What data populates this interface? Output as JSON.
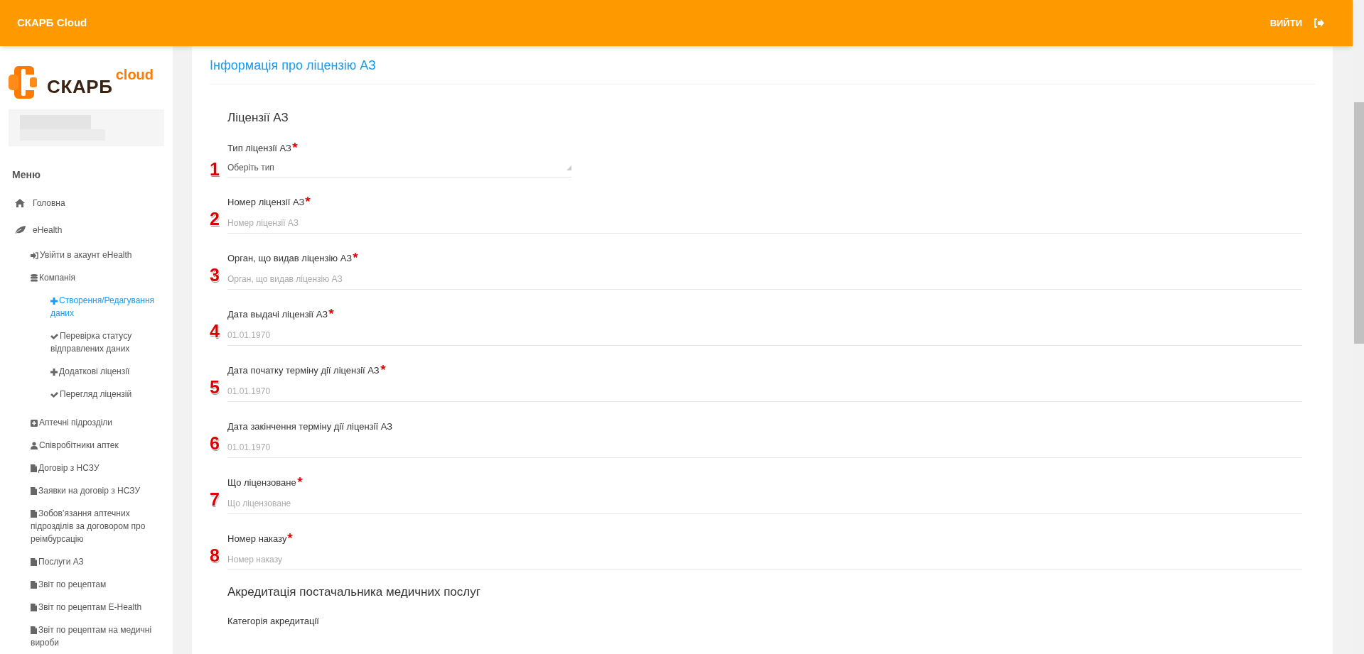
{
  "header": {
    "brand": "СКАРБ Cloud",
    "logout": "ВИЙТИ"
  },
  "sidebar": {
    "logo": {
      "word": "СКАРБ",
      "suffix": "cloud"
    },
    "menu_title": "Меню",
    "items": [
      {
        "label": "Головна",
        "selected": false
      },
      {
        "label": "eHealth",
        "selected": false,
        "children": [
          {
            "label": "Увійти в акаунт eHealth",
            "selected": false
          },
          {
            "label": "Компанія",
            "selected": false,
            "children": [
              {
                "label": "Створення/Редагування даних",
                "selected": true
              },
              {
                "label": "Перевірка статусу відправлених даних",
                "selected": false
              },
              {
                "label": "Додаткові ліцензії",
                "selected": false
              },
              {
                "label": "Перегляд ліцензій",
                "selected": false
              }
            ]
          },
          {
            "label": "Аптечні підрозділи",
            "selected": false
          },
          {
            "label": "Співробітники аптек",
            "selected": false
          },
          {
            "label": "Договір з НСЗУ",
            "selected": false
          },
          {
            "label": "Заявки на договір з НСЗУ",
            "selected": false
          },
          {
            "label": "Зобов’язання аптечних підрозділів за договором про реімбурсацію",
            "selected": false
          },
          {
            "label": "Послуги АЗ",
            "selected": false
          },
          {
            "label": "Звіт по рецептам",
            "selected": false
          },
          {
            "label": "Звіт по рецептам E-Health",
            "selected": false
          },
          {
            "label": "Звіт по рецептам на медичні вироби",
            "selected": false
          }
        ]
      }
    ]
  },
  "page": {
    "title": "Інформація про ліцензію АЗ",
    "sections": [
      {
        "title": "Ліцензії АЗ",
        "fields": [
          {
            "kind": "select",
            "label": "Тип ліцензії АЗ",
            "required": true,
            "placeholder": "Оберіть тип",
            "marker": "1"
          },
          {
            "kind": "input",
            "label": "Номер ліцензії АЗ",
            "required": true,
            "placeholder": "Номер ліцензії АЗ",
            "marker": "2"
          },
          {
            "kind": "input",
            "label": "Орган, що видав ліцензію АЗ",
            "required": true,
            "placeholder": "Орган, що видав ліцензію АЗ",
            "marker": "3"
          },
          {
            "kind": "input",
            "label": "Дата выдачі ліцензії АЗ",
            "required": true,
            "placeholder": "01.01.1970",
            "marker": "4"
          },
          {
            "kind": "input",
            "label": "Дата початку терміну дії ліцензії АЗ",
            "required": true,
            "placeholder": "01.01.1970",
            "marker": "5"
          },
          {
            "kind": "input",
            "label": "Дата закінчення терміну дії ліцензії АЗ",
            "required": false,
            "placeholder": "01.01.1970",
            "marker": "6"
          },
          {
            "kind": "input",
            "label": "Що ліцензоване",
            "required": true,
            "placeholder": "Що ліцензоване",
            "marker": "7"
          },
          {
            "kind": "input",
            "label": "Номер наказу",
            "required": true,
            "placeholder": "Номер наказу",
            "marker": "8"
          }
        ]
      },
      {
        "title": "Акредитація постачальника медичних послуг",
        "fields": [
          {
            "kind": "label",
            "label": "Категорія акредитації",
            "required": false
          }
        ]
      }
    ]
  }
}
